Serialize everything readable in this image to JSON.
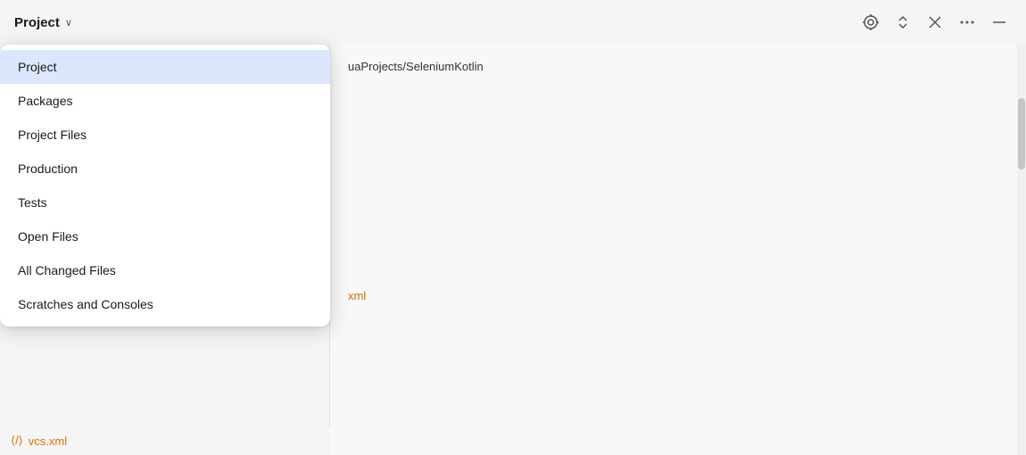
{
  "toolbar": {
    "title": "Project",
    "chevron": "∨",
    "icons": {
      "target": "⊕",
      "expand_collapse": "⌃⌄",
      "close": "✕",
      "more": "⋯",
      "minimize": "—"
    }
  },
  "main_content": {
    "path": "uaProjects/SeleniumKotlin",
    "xml_label": "xml"
  },
  "dropdown": {
    "items": [
      {
        "id": "project",
        "label": "Project",
        "selected": true
      },
      {
        "id": "packages",
        "label": "Packages",
        "selected": false
      },
      {
        "id": "project-files",
        "label": "Project Files",
        "selected": false
      },
      {
        "id": "production",
        "label": "Production",
        "selected": false
      },
      {
        "id": "tests",
        "label": "Tests",
        "selected": false
      },
      {
        "id": "open-files",
        "label": "Open Files",
        "selected": false
      },
      {
        "id": "all-changed-files",
        "label": "All Changed Files",
        "selected": false
      },
      {
        "id": "scratches-consoles",
        "label": "Scratches and Consoles",
        "selected": false
      }
    ]
  },
  "bottom_bar": {
    "vcs_icon": "⟨/⟩",
    "vcs_label": "vcs.xml"
  },
  "colors": {
    "selected_bg": "#dce6fc",
    "accent": "#c07000"
  }
}
